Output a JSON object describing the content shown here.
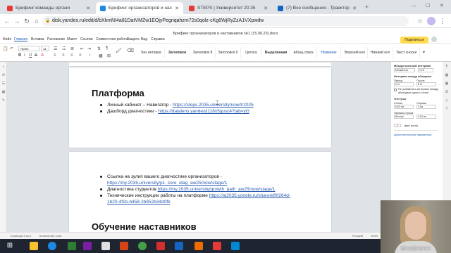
{
  "browser": {
    "tabs": [
      {
        "label": "Брифинг команды органи",
        "favicon_color": "#e53935",
        "active": false
      },
      {
        "label": "Брифинг организаторов и нас",
        "favicon_color": "#1e88e5",
        "active": true
      },
      {
        "label": "STEPS | Университет 20.35",
        "favicon_color": "#e53935",
        "active": false
      },
      {
        "label": "(7) Все сообщения - Траектор",
        "favicon_color": "#1565c0",
        "active": false
      }
    ],
    "new_tab": "+",
    "address": "disk.yandex.ru/edit/d/bXkmNI4a81DatVMZw1EOjyPegnqahzm72s0qolz-cKg6WjRyZzA1VXpwdw"
  },
  "doc": {
    "title": "Брифинг организаторов и наставников №1 (15.06.23).docx",
    "share_label": "Поделиться",
    "menu": [
      "Файл",
      "Главная",
      "Вставка",
      "Рисование",
      "Макет",
      "Ссылки",
      "Совместная работа",
      "Защита",
      "Вид",
      "Справка"
    ],
    "font_name": "Aptos",
    "font_size": "11",
    "styles": [
      "Без интерва",
      "Заголовок",
      "Заголовок 8",
      "Заголовок 9",
      "Цитата",
      "Выделенная",
      "Абзац списк",
      "Название",
      "Верхний кол",
      "Нижний кол",
      "Текст сноски"
    ]
  },
  "page1": {
    "heading": "Платформа",
    "bullets": [
      {
        "text": "Личный кабинет – Навигатор - ",
        "link": "https://steps.2035.university/now/tr2025"
      },
      {
        "text": "Дашборд диагностики - ",
        "link": "https://datalens.yandex/j118x5gusc4?tab=yG"
      }
    ]
  },
  "page2": {
    "bullets": [
      {
        "text": "Ссылка на зулип вашего диагностике организаторов -",
        "link": "https://my.2035.university/p1_core_diag_aw25/now/stage/1"
      },
      {
        "text": "Диагностика студентов ",
        "link": "https://my.2035.university/growth_path_aw25/now/stage/1"
      },
      {
        "text": "Технические инструкции работы на платформе ",
        "link": "https://ai2035.yonote.ru/share/ef0f264d-",
        "link2": "1b20-4f1b-b458-2b952b34d0fb"
      }
    ],
    "heading": "Обучение наставников"
  },
  "right_panel": {
    "section1": "Междустрочный интервал",
    "line_spacing_type": "Множитель",
    "line_spacing_value": "1.15",
    "section2": "Интервал между абзацами",
    "before_label": "Перед",
    "after_label": "После",
    "before_value": "0 пт",
    "after_value": "8 пт",
    "no_space_label": "Не добавлять интервал между абзацами одного стиля",
    "section3": "Отступы",
    "left_label": "Слева",
    "right_label": "Справа",
    "left_value": "0.63 см",
    "right_value": "0 см",
    "first_line_label": "Первая строка",
    "first_line_type": "Выступ",
    "first_line_value": "0.63 см",
    "bg_color_label": "Цвет фона",
    "advanced_label": "Дополнительные параметры"
  },
  "status": {
    "page": "Страница 3 из 6",
    "words": "Количество слов",
    "lang": "Русский",
    "zoom": "100%"
  },
  "webcam": {
    "name": "Ирина Данилевич"
  }
}
